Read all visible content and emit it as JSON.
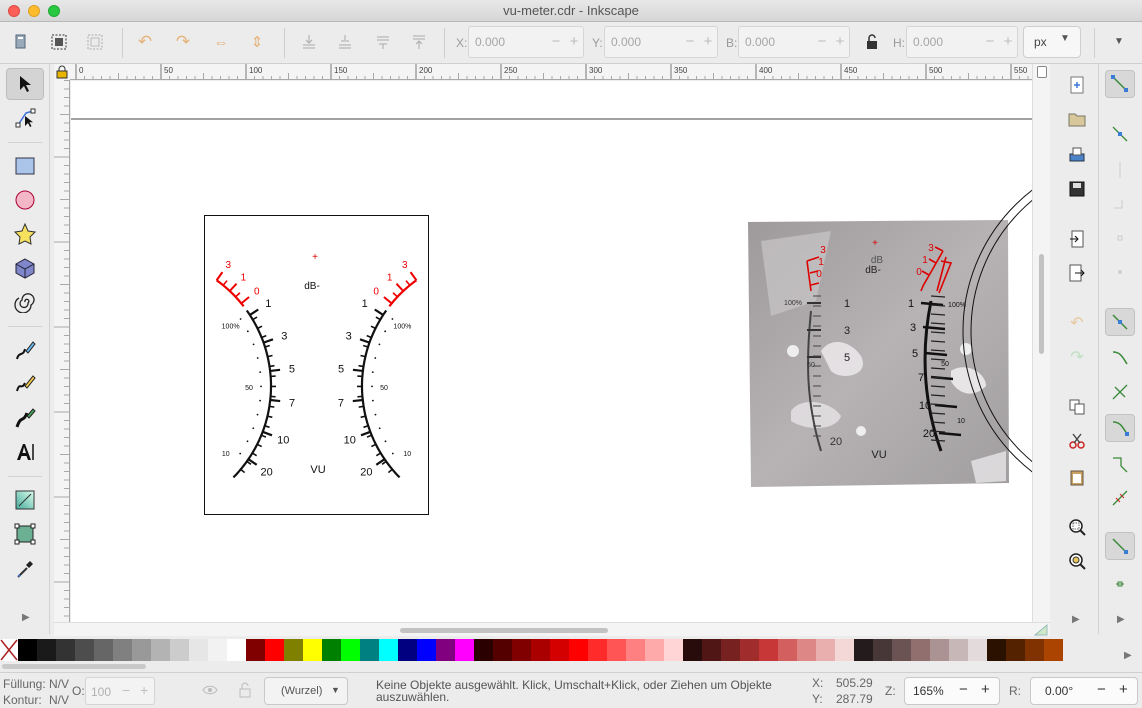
{
  "window": {
    "title": "vu-meter.cdr - Inkscape"
  },
  "toolbar": {
    "x_label": "X:",
    "x_value": "0.000",
    "y_label": "Y:",
    "y_value": "0.000",
    "w_label": "B:",
    "w_value": "0.000",
    "h_label": "H:",
    "h_value": "0.000",
    "unit": "px"
  },
  "ruler": {
    "top_ticks": [
      "0",
      "50",
      "100",
      "150",
      "200",
      "250",
      "300",
      "350",
      "400",
      "450",
      "500",
      "550"
    ]
  },
  "meter": {
    "db_label": "dB-",
    "vu_label": "VU",
    "red_scale": [
      "3",
      "1",
      "0"
    ],
    "black_scale": [
      "1",
      "3",
      "5",
      "7",
      "10",
      "20"
    ],
    "pct": [
      "100%",
      "50",
      "10"
    ],
    "photo_db_top": "dB",
    "photo_db": "dB-"
  },
  "palette": {
    "colors": [
      "#000000",
      "#1a1a1a",
      "#333333",
      "#4d4d4d",
      "#666666",
      "#808080",
      "#999999",
      "#b3b3b3",
      "#cccccc",
      "#e6e6e6",
      "#f2f2f2",
      "#ffffff",
      "#800000",
      "#ff0000",
      "#808000",
      "#ffff00",
      "#008000",
      "#00ff00",
      "#008080",
      "#00ffff",
      "#000080",
      "#0000ff",
      "#800080",
      "#ff00ff",
      "#2b0000",
      "#550000",
      "#800000",
      "#aa0000",
      "#d40000",
      "#ff0000",
      "#ff2a2a",
      "#ff5555",
      "#ff8080",
      "#ffaaaa",
      "#ffd5d5",
      "#280b0b",
      "#501616",
      "#782121",
      "#a02c2c",
      "#c83737",
      "#d35f5f",
      "#de8787",
      "#e9afaf",
      "#f4d7d7",
      "#241c1c",
      "#483737",
      "#6c5353",
      "#916f6f",
      "#ac9393",
      "#c8b7b7",
      "#e3dbdb",
      "#2b1100",
      "#552200",
      "#803300",
      "#aa4400"
    ]
  },
  "status": {
    "fill_label": "Füllung:",
    "fill_value": "N/V",
    "stroke_label": "Kontur:",
    "stroke_value": "N/V",
    "opacity_label": "O:",
    "opacity_value": "100",
    "layer": "(Wurzel)",
    "message": "Keine Objekte ausgewählt. Klick, Umschalt+Klick, oder Ziehen um Objekte auszuwählen.",
    "x_label": "X:",
    "x_value": "505.29",
    "y_label": "Y:",
    "y_value": "287.79",
    "zoom_label": "Z:",
    "zoom_value": "165%",
    "rot_label": "R:",
    "rot_value": "0.00°"
  }
}
